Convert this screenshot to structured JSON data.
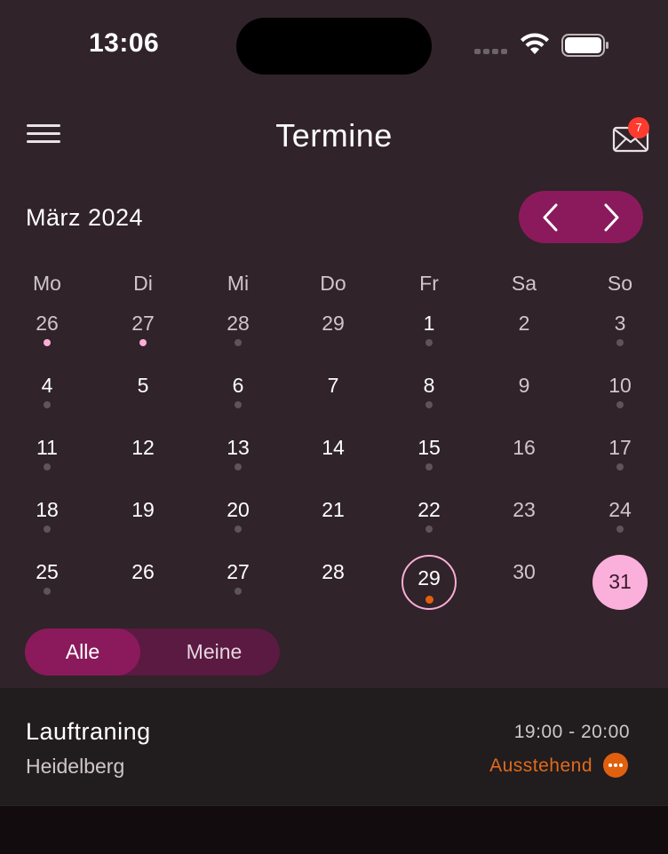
{
  "status_bar": {
    "time": "13:06"
  },
  "header": {
    "title": "Termine",
    "mail_badge": "7",
    "menu_icon": "hamburger-icon",
    "mail_icon": "mail-icon"
  },
  "calendar": {
    "month_label": "März 2024",
    "weekdays": [
      "Mo",
      "Di",
      "Mi",
      "Do",
      "Fr",
      "Sa",
      "So"
    ],
    "weeks": [
      [
        {
          "d": "26",
          "dot": "pink",
          "muted": true
        },
        {
          "d": "27",
          "dot": "pink",
          "muted": true
        },
        {
          "d": "28",
          "dot": "grey",
          "muted": true
        },
        {
          "d": "29",
          "dot": "",
          "muted": true
        },
        {
          "d": "1",
          "dot": "grey",
          "muted": false
        },
        {
          "d": "2",
          "dot": "",
          "muted": true
        },
        {
          "d": "3",
          "dot": "grey",
          "muted": true
        }
      ],
      [
        {
          "d": "4",
          "dot": "grey",
          "muted": false
        },
        {
          "d": "5",
          "dot": "",
          "muted": false
        },
        {
          "d": "6",
          "dot": "grey",
          "muted": false
        },
        {
          "d": "7",
          "dot": "",
          "muted": false
        },
        {
          "d": "8",
          "dot": "grey",
          "muted": false
        },
        {
          "d": "9",
          "dot": "",
          "muted": true
        },
        {
          "d": "10",
          "dot": "grey",
          "muted": true
        }
      ],
      [
        {
          "d": "11",
          "dot": "grey",
          "muted": false
        },
        {
          "d": "12",
          "dot": "",
          "muted": false
        },
        {
          "d": "13",
          "dot": "grey",
          "muted": false
        },
        {
          "d": "14",
          "dot": "",
          "muted": false
        },
        {
          "d": "15",
          "dot": "grey",
          "muted": false
        },
        {
          "d": "16",
          "dot": "",
          "muted": true
        },
        {
          "d": "17",
          "dot": "grey",
          "muted": true
        }
      ],
      [
        {
          "d": "18",
          "dot": "grey",
          "muted": false
        },
        {
          "d": "19",
          "dot": "",
          "muted": false
        },
        {
          "d": "20",
          "dot": "grey",
          "muted": false
        },
        {
          "d": "21",
          "dot": "",
          "muted": false
        },
        {
          "d": "22",
          "dot": "grey",
          "muted": false
        },
        {
          "d": "23",
          "dot": "",
          "muted": true
        },
        {
          "d": "24",
          "dot": "grey",
          "muted": true
        }
      ],
      [
        {
          "d": "25",
          "dot": "grey",
          "muted": false
        },
        {
          "d": "26",
          "dot": "",
          "muted": false
        },
        {
          "d": "27",
          "dot": "grey",
          "muted": false
        },
        {
          "d": "28",
          "dot": "",
          "muted": false
        },
        {
          "d": "29",
          "dot": "orange",
          "muted": false,
          "today": true
        },
        {
          "d": "30",
          "dot": "",
          "muted": true
        },
        {
          "d": "31",
          "dot": "",
          "muted": false,
          "selected": true
        }
      ]
    ]
  },
  "filter": {
    "all_label": "Alle",
    "mine_label": "Meine",
    "active": "Alle"
  },
  "events": [
    {
      "title": "Lauftraning",
      "location": "Heidelberg",
      "time": "19:00 - 20:00",
      "status": "Ausstehend"
    }
  ],
  "colors": {
    "accent": "#8a1a5c",
    "selected_day": "#fbb0dc",
    "dot_pink": "#f7aed8",
    "dot_grey": "#5d5559",
    "dot_orange": "#e0600f",
    "status_orange": "#e06a1c",
    "badge_red": "#ff3b30"
  }
}
